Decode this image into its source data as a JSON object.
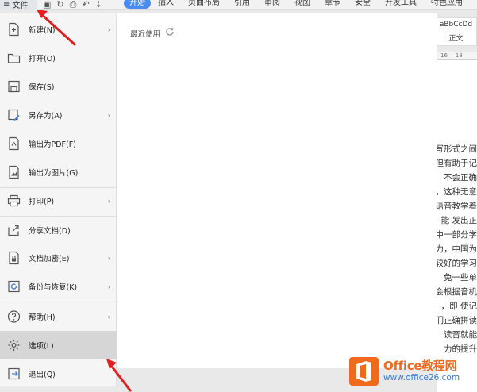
{
  "toolbar": {
    "file_label": "文件",
    "tabs": [
      "开始",
      "插入",
      "页面布局",
      "引用",
      "审阅",
      "视图",
      "章节",
      "安全",
      "开发工具",
      "特色应用"
    ]
  },
  "style_gallery": {
    "sample": "aBbCcDd",
    "name": "正文"
  },
  "ruler": {
    "ticks": [
      "16",
      "18"
    ]
  },
  "menu": {
    "items": [
      {
        "label": "新建(N)",
        "icon": "new-doc-icon",
        "has_arrow": true
      },
      {
        "label": "打开(O)",
        "icon": "folder-open-icon",
        "has_arrow": false
      },
      {
        "label": "保存(S)",
        "icon": "save-icon",
        "has_arrow": false
      },
      {
        "label": "另存为(A)",
        "icon": "save-as-icon",
        "has_arrow": true
      },
      {
        "label": "输出为PDF(F)",
        "icon": "export-pdf-icon",
        "has_arrow": false
      },
      {
        "label": "输出为图片(G)",
        "icon": "export-image-icon",
        "has_arrow": false
      },
      {
        "label": "打印(P)",
        "icon": "print-icon",
        "has_arrow": true
      },
      {
        "label": "分享文档(D)",
        "icon": "share-icon",
        "has_arrow": false
      },
      {
        "label": "文档加密(E)",
        "icon": "encrypt-doc-icon",
        "has_arrow": true
      },
      {
        "label": "备份与恢复(K)",
        "icon": "backup-restore-icon",
        "has_arrow": true
      },
      {
        "label": "帮助(H)",
        "icon": "help-icon",
        "has_arrow": true
      },
      {
        "label": "选项(L)",
        "icon": "gear-icon",
        "has_arrow": false,
        "selected": true
      },
      {
        "label": "退出(Q)",
        "icon": "exit-icon",
        "has_arrow": false
      }
    ],
    "arrow_glyph": "›"
  },
  "recent": {
    "title": "最近使用"
  },
  "document_lines": [
    "写形式之间",
    "但有助于记",
    "不会正确",
    "，这种无意",
    "语音教学着",
    "能  发出正",
    "中一部分学",
    "力，中国为",
    "较好的学习",
    "免一些单",
    "会根据音机",
    "，即  使记",
    "们正确拼读",
    "读音就能",
    "力的提升"
  ],
  "watermark": {
    "brand": "Office教程网",
    "url": "www.office26.com"
  },
  "colors": {
    "accent": "#4a8af4",
    "brand_orange": "#f06a1c",
    "url_blue": "#3a7bd5",
    "arrow_red": "#e02020"
  }
}
